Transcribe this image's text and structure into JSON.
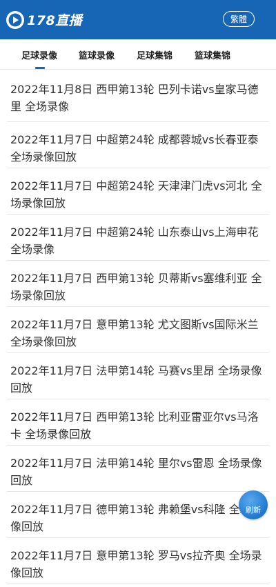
{
  "header": {
    "logo_text": "178直播",
    "lang_button": "繁體"
  },
  "tabs": [
    {
      "label": "足球录像"
    },
    {
      "label": "篮球录像"
    },
    {
      "label": "足球集锦"
    },
    {
      "label": "篮球集锦"
    }
  ],
  "items": [
    {
      "title": "2022年11月8日 西甲第13轮 巴列卡诺vs皇家马德里 全场录像"
    },
    {
      "title": "2022年11月7日 中超第24轮 成都蓉城vs长春亚泰 全场录像回放"
    },
    {
      "title": "2022年11月7日 中超第24轮 天津津门虎vs河北 全场录像回放"
    },
    {
      "title": "2022年11月7日 中超第24轮 山东泰山vs上海申花 全场录像"
    },
    {
      "title": "2022年11月7日 西甲第13轮 贝蒂斯vs塞维利亚 全场录像回放"
    },
    {
      "title": "2022年11月7日 意甲第13轮 尤文图斯vs国际米兰 全场录像回放"
    },
    {
      "title": "2022年11月7日 法甲第14轮 马赛vs里昂 全场录像回放"
    },
    {
      "title": "2022年11月7日 西甲第13轮 比利亚雷亚尔vs马洛卡 全场录像回放"
    },
    {
      "title": "2022年11月7日 法甲第14轮 里尔vs雷恩 全场录像回放"
    },
    {
      "title": "2022年11月7日 德甲第13轮 弗赖堡vs科隆 全场录像回放"
    },
    {
      "title": "2022年11月7日 意甲第13轮 罗马vs拉齐奥 全场录像回放"
    }
  ],
  "refresh_label": "刷新",
  "colors": {
    "brand": "#1766b6",
    "text": "#333333"
  }
}
